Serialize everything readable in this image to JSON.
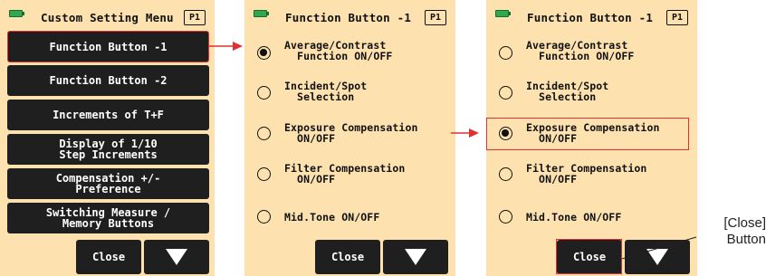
{
  "screen1": {
    "title": "Custom Setting Menu",
    "page_badge": "P1",
    "menu_items": [
      {
        "label": "Function Button -1",
        "selected": true
      },
      {
        "label": "Function Button -2",
        "selected": false
      },
      {
        "label": "Increments of T+F",
        "selected": false
      },
      {
        "label": "Display of 1/10\nStep Increments",
        "selected": false
      },
      {
        "label": "Compensation +/-\nPreference",
        "selected": false
      },
      {
        "label": "Switching Measure /\nMemory Buttons",
        "selected": false
      }
    ],
    "close_label": "Close",
    "down_icon": "down-triangle-icon"
  },
  "screen2": {
    "title": "Function Button -1",
    "page_badge": "P1",
    "options": [
      {
        "label": "Average/Contrast\n  Function ON/OFF",
        "checked": true
      },
      {
        "label": "Incident/Spot\n  Selection",
        "checked": false
      },
      {
        "label": "Exposure Compensation\n  ON/OFF",
        "checked": false
      },
      {
        "label": "Filter Compensation\n  ON/OFF",
        "checked": false
      },
      {
        "label": "Mid.Tone ON/OFF",
        "checked": false
      }
    ],
    "close_label": "Close"
  },
  "screen3": {
    "title": "Function Button -1",
    "page_badge": "P1",
    "options": [
      {
        "label": "Average/Contrast\n  Function ON/OFF",
        "checked": false
      },
      {
        "label": "Incident/Spot\n  Selection",
        "checked": false
      },
      {
        "label": "Exposure Compensation\n  ON/OFF",
        "checked": true
      },
      {
        "label": "Filter Compensation\n  ON/OFF",
        "checked": false
      },
      {
        "label": "Mid.Tone ON/OFF",
        "checked": false
      }
    ],
    "close_label": "Close"
  },
  "callout": {
    "line1": "[Close]",
    "line2": "Button"
  },
  "colors": {
    "background": "#fde2b0",
    "button": "#1f1f1f",
    "highlight": "#e03030",
    "battery": "#2fa84f"
  }
}
